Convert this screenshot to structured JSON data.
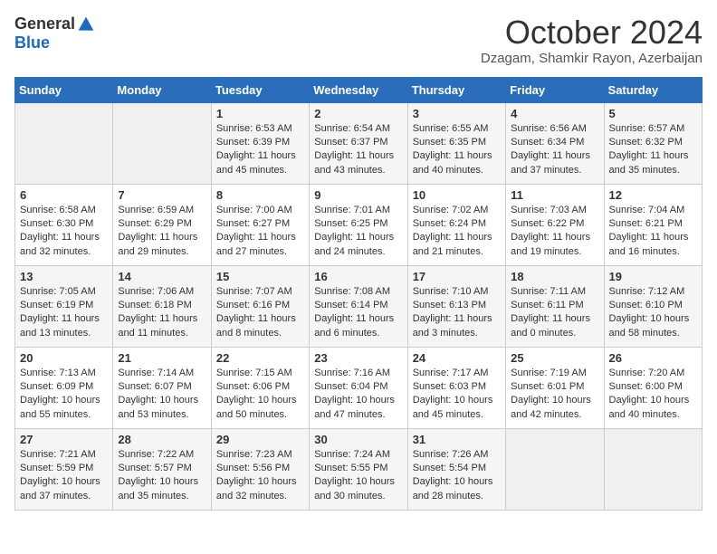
{
  "header": {
    "logo_general": "General",
    "logo_blue": "Blue",
    "month_title": "October 2024",
    "location": "Dzagam, Shamkir Rayon, Azerbaijan"
  },
  "weekdays": [
    "Sunday",
    "Monday",
    "Tuesday",
    "Wednesday",
    "Thursday",
    "Friday",
    "Saturday"
  ],
  "weeks": [
    [
      {
        "day": "",
        "sunrise": "",
        "sunset": "",
        "daylight": ""
      },
      {
        "day": "",
        "sunrise": "",
        "sunset": "",
        "daylight": ""
      },
      {
        "day": "1",
        "sunrise": "Sunrise: 6:53 AM",
        "sunset": "Sunset: 6:39 PM",
        "daylight": "Daylight: 11 hours and 45 minutes."
      },
      {
        "day": "2",
        "sunrise": "Sunrise: 6:54 AM",
        "sunset": "Sunset: 6:37 PM",
        "daylight": "Daylight: 11 hours and 43 minutes."
      },
      {
        "day": "3",
        "sunrise": "Sunrise: 6:55 AM",
        "sunset": "Sunset: 6:35 PM",
        "daylight": "Daylight: 11 hours and 40 minutes."
      },
      {
        "day": "4",
        "sunrise": "Sunrise: 6:56 AM",
        "sunset": "Sunset: 6:34 PM",
        "daylight": "Daylight: 11 hours and 37 minutes."
      },
      {
        "day": "5",
        "sunrise": "Sunrise: 6:57 AM",
        "sunset": "Sunset: 6:32 PM",
        "daylight": "Daylight: 11 hours and 35 minutes."
      }
    ],
    [
      {
        "day": "6",
        "sunrise": "Sunrise: 6:58 AM",
        "sunset": "Sunset: 6:30 PM",
        "daylight": "Daylight: 11 hours and 32 minutes."
      },
      {
        "day": "7",
        "sunrise": "Sunrise: 6:59 AM",
        "sunset": "Sunset: 6:29 PM",
        "daylight": "Daylight: 11 hours and 29 minutes."
      },
      {
        "day": "8",
        "sunrise": "Sunrise: 7:00 AM",
        "sunset": "Sunset: 6:27 PM",
        "daylight": "Daylight: 11 hours and 27 minutes."
      },
      {
        "day": "9",
        "sunrise": "Sunrise: 7:01 AM",
        "sunset": "Sunset: 6:25 PM",
        "daylight": "Daylight: 11 hours and 24 minutes."
      },
      {
        "day": "10",
        "sunrise": "Sunrise: 7:02 AM",
        "sunset": "Sunset: 6:24 PM",
        "daylight": "Daylight: 11 hours and 21 minutes."
      },
      {
        "day": "11",
        "sunrise": "Sunrise: 7:03 AM",
        "sunset": "Sunset: 6:22 PM",
        "daylight": "Daylight: 11 hours and 19 minutes."
      },
      {
        "day": "12",
        "sunrise": "Sunrise: 7:04 AM",
        "sunset": "Sunset: 6:21 PM",
        "daylight": "Daylight: 11 hours and 16 minutes."
      }
    ],
    [
      {
        "day": "13",
        "sunrise": "Sunrise: 7:05 AM",
        "sunset": "Sunset: 6:19 PM",
        "daylight": "Daylight: 11 hours and 13 minutes."
      },
      {
        "day": "14",
        "sunrise": "Sunrise: 7:06 AM",
        "sunset": "Sunset: 6:18 PM",
        "daylight": "Daylight: 11 hours and 11 minutes."
      },
      {
        "day": "15",
        "sunrise": "Sunrise: 7:07 AM",
        "sunset": "Sunset: 6:16 PM",
        "daylight": "Daylight: 11 hours and 8 minutes."
      },
      {
        "day": "16",
        "sunrise": "Sunrise: 7:08 AM",
        "sunset": "Sunset: 6:14 PM",
        "daylight": "Daylight: 11 hours and 6 minutes."
      },
      {
        "day": "17",
        "sunrise": "Sunrise: 7:10 AM",
        "sunset": "Sunset: 6:13 PM",
        "daylight": "Daylight: 11 hours and 3 minutes."
      },
      {
        "day": "18",
        "sunrise": "Sunrise: 7:11 AM",
        "sunset": "Sunset: 6:11 PM",
        "daylight": "Daylight: 11 hours and 0 minutes."
      },
      {
        "day": "19",
        "sunrise": "Sunrise: 7:12 AM",
        "sunset": "Sunset: 6:10 PM",
        "daylight": "Daylight: 10 hours and 58 minutes."
      }
    ],
    [
      {
        "day": "20",
        "sunrise": "Sunrise: 7:13 AM",
        "sunset": "Sunset: 6:09 PM",
        "daylight": "Daylight: 10 hours and 55 minutes."
      },
      {
        "day": "21",
        "sunrise": "Sunrise: 7:14 AM",
        "sunset": "Sunset: 6:07 PM",
        "daylight": "Daylight: 10 hours and 53 minutes."
      },
      {
        "day": "22",
        "sunrise": "Sunrise: 7:15 AM",
        "sunset": "Sunset: 6:06 PM",
        "daylight": "Daylight: 10 hours and 50 minutes."
      },
      {
        "day": "23",
        "sunrise": "Sunrise: 7:16 AM",
        "sunset": "Sunset: 6:04 PM",
        "daylight": "Daylight: 10 hours and 47 minutes."
      },
      {
        "day": "24",
        "sunrise": "Sunrise: 7:17 AM",
        "sunset": "Sunset: 6:03 PM",
        "daylight": "Daylight: 10 hours and 45 minutes."
      },
      {
        "day": "25",
        "sunrise": "Sunrise: 7:19 AM",
        "sunset": "Sunset: 6:01 PM",
        "daylight": "Daylight: 10 hours and 42 minutes."
      },
      {
        "day": "26",
        "sunrise": "Sunrise: 7:20 AM",
        "sunset": "Sunset: 6:00 PM",
        "daylight": "Daylight: 10 hours and 40 minutes."
      }
    ],
    [
      {
        "day": "27",
        "sunrise": "Sunrise: 7:21 AM",
        "sunset": "Sunset: 5:59 PM",
        "daylight": "Daylight: 10 hours and 37 minutes."
      },
      {
        "day": "28",
        "sunrise": "Sunrise: 7:22 AM",
        "sunset": "Sunset: 5:57 PM",
        "daylight": "Daylight: 10 hours and 35 minutes."
      },
      {
        "day": "29",
        "sunrise": "Sunrise: 7:23 AM",
        "sunset": "Sunset: 5:56 PM",
        "daylight": "Daylight: 10 hours and 32 minutes."
      },
      {
        "day": "30",
        "sunrise": "Sunrise: 7:24 AM",
        "sunset": "Sunset: 5:55 PM",
        "daylight": "Daylight: 10 hours and 30 minutes."
      },
      {
        "day": "31",
        "sunrise": "Sunrise: 7:26 AM",
        "sunset": "Sunset: 5:54 PM",
        "daylight": "Daylight: 10 hours and 28 minutes."
      },
      {
        "day": "",
        "sunrise": "",
        "sunset": "",
        "daylight": ""
      },
      {
        "day": "",
        "sunrise": "",
        "sunset": "",
        "daylight": ""
      }
    ]
  ]
}
